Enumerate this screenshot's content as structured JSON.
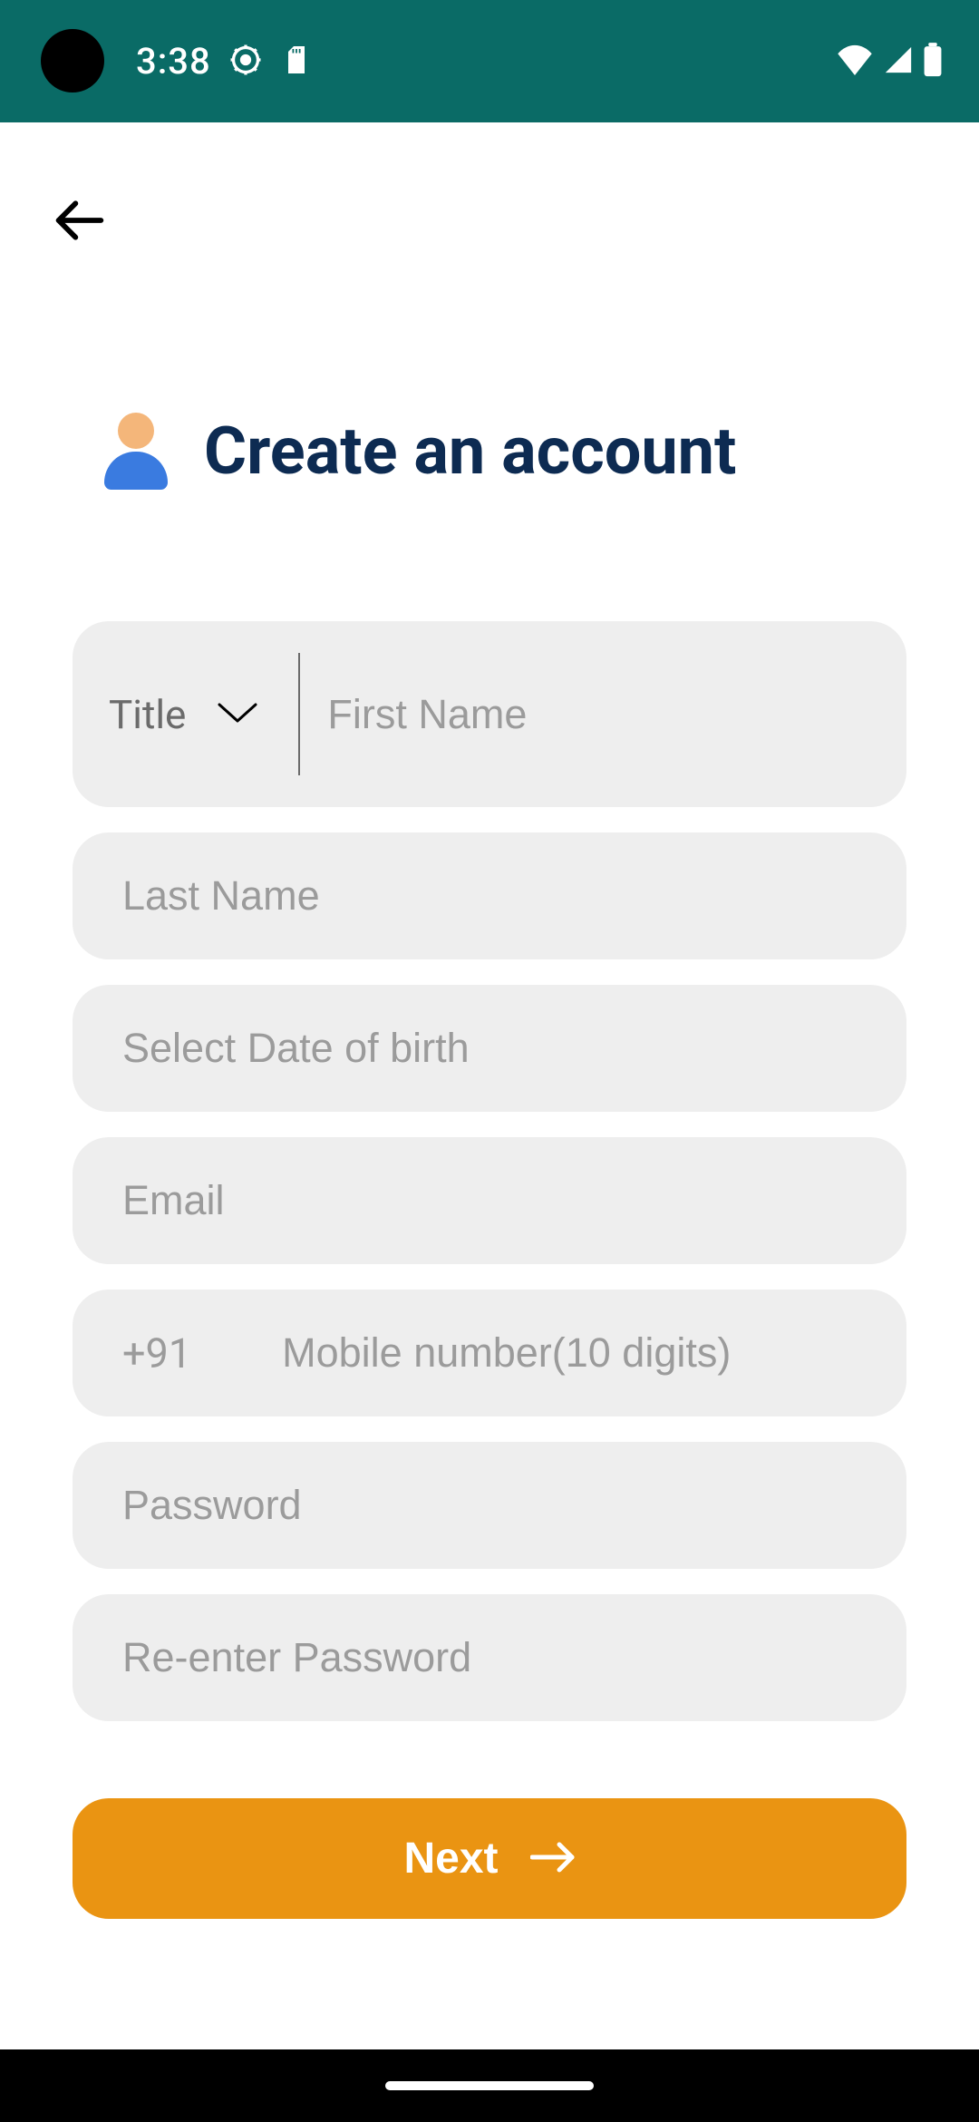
{
  "statusbar": {
    "time": "3:38"
  },
  "header": {
    "title": "Create an account"
  },
  "form": {
    "title_label": "Title",
    "first_name_placeholder": "First Name",
    "last_name_placeholder": "Last Name",
    "dob_placeholder": "Select Date of birth",
    "email_placeholder": "Email",
    "phone_prefix": "+91",
    "mobile_placeholder": "Mobile number(10 digits)",
    "password_placeholder": "Password",
    "reenter_password_placeholder": "Re-enter Password"
  },
  "actions": {
    "next_label": "Next"
  }
}
